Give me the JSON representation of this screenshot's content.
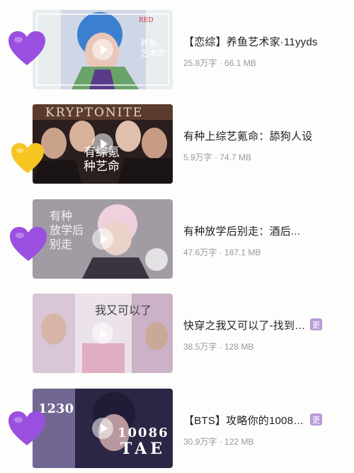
{
  "items": [
    {
      "title": "【恋综】养鱼艺术家·11yyds",
      "words": "25.8万字",
      "size": "66.1 MB",
      "thumb_text": "养鱼\n艺术家",
      "thumb_tag": "RED"
    },
    {
      "title": "有种上综艺氪命：舔狗人设",
      "words": "5.9万字",
      "size": "74.7 MB",
      "thumb_text": "有综氪\n种艺命",
      "thumb_tag": "KRYPTONITE"
    },
    {
      "title": "有种放学后别走：酒后...",
      "words": "47.6万字",
      "size": "187.1 MB",
      "thumb_text": "有种\n放学后\n别走"
    },
    {
      "title": "快穿之我又可以了-找到…",
      "words": "38.5万字",
      "size": "128 MB",
      "thumb_text": "我又可以了",
      "badge": "更"
    },
    {
      "title": "【BTS】攻略你的1008…",
      "words": "30.9万字",
      "size": "122 MB",
      "thumb_text": "10086",
      "thumb_tag": "TAE",
      "thumb_num": "1230",
      "badge": "更"
    }
  ],
  "meta_separator": " · ",
  "heart_colors": {
    "purple": "#9b4fe0",
    "yellow": "#f6c521"
  }
}
